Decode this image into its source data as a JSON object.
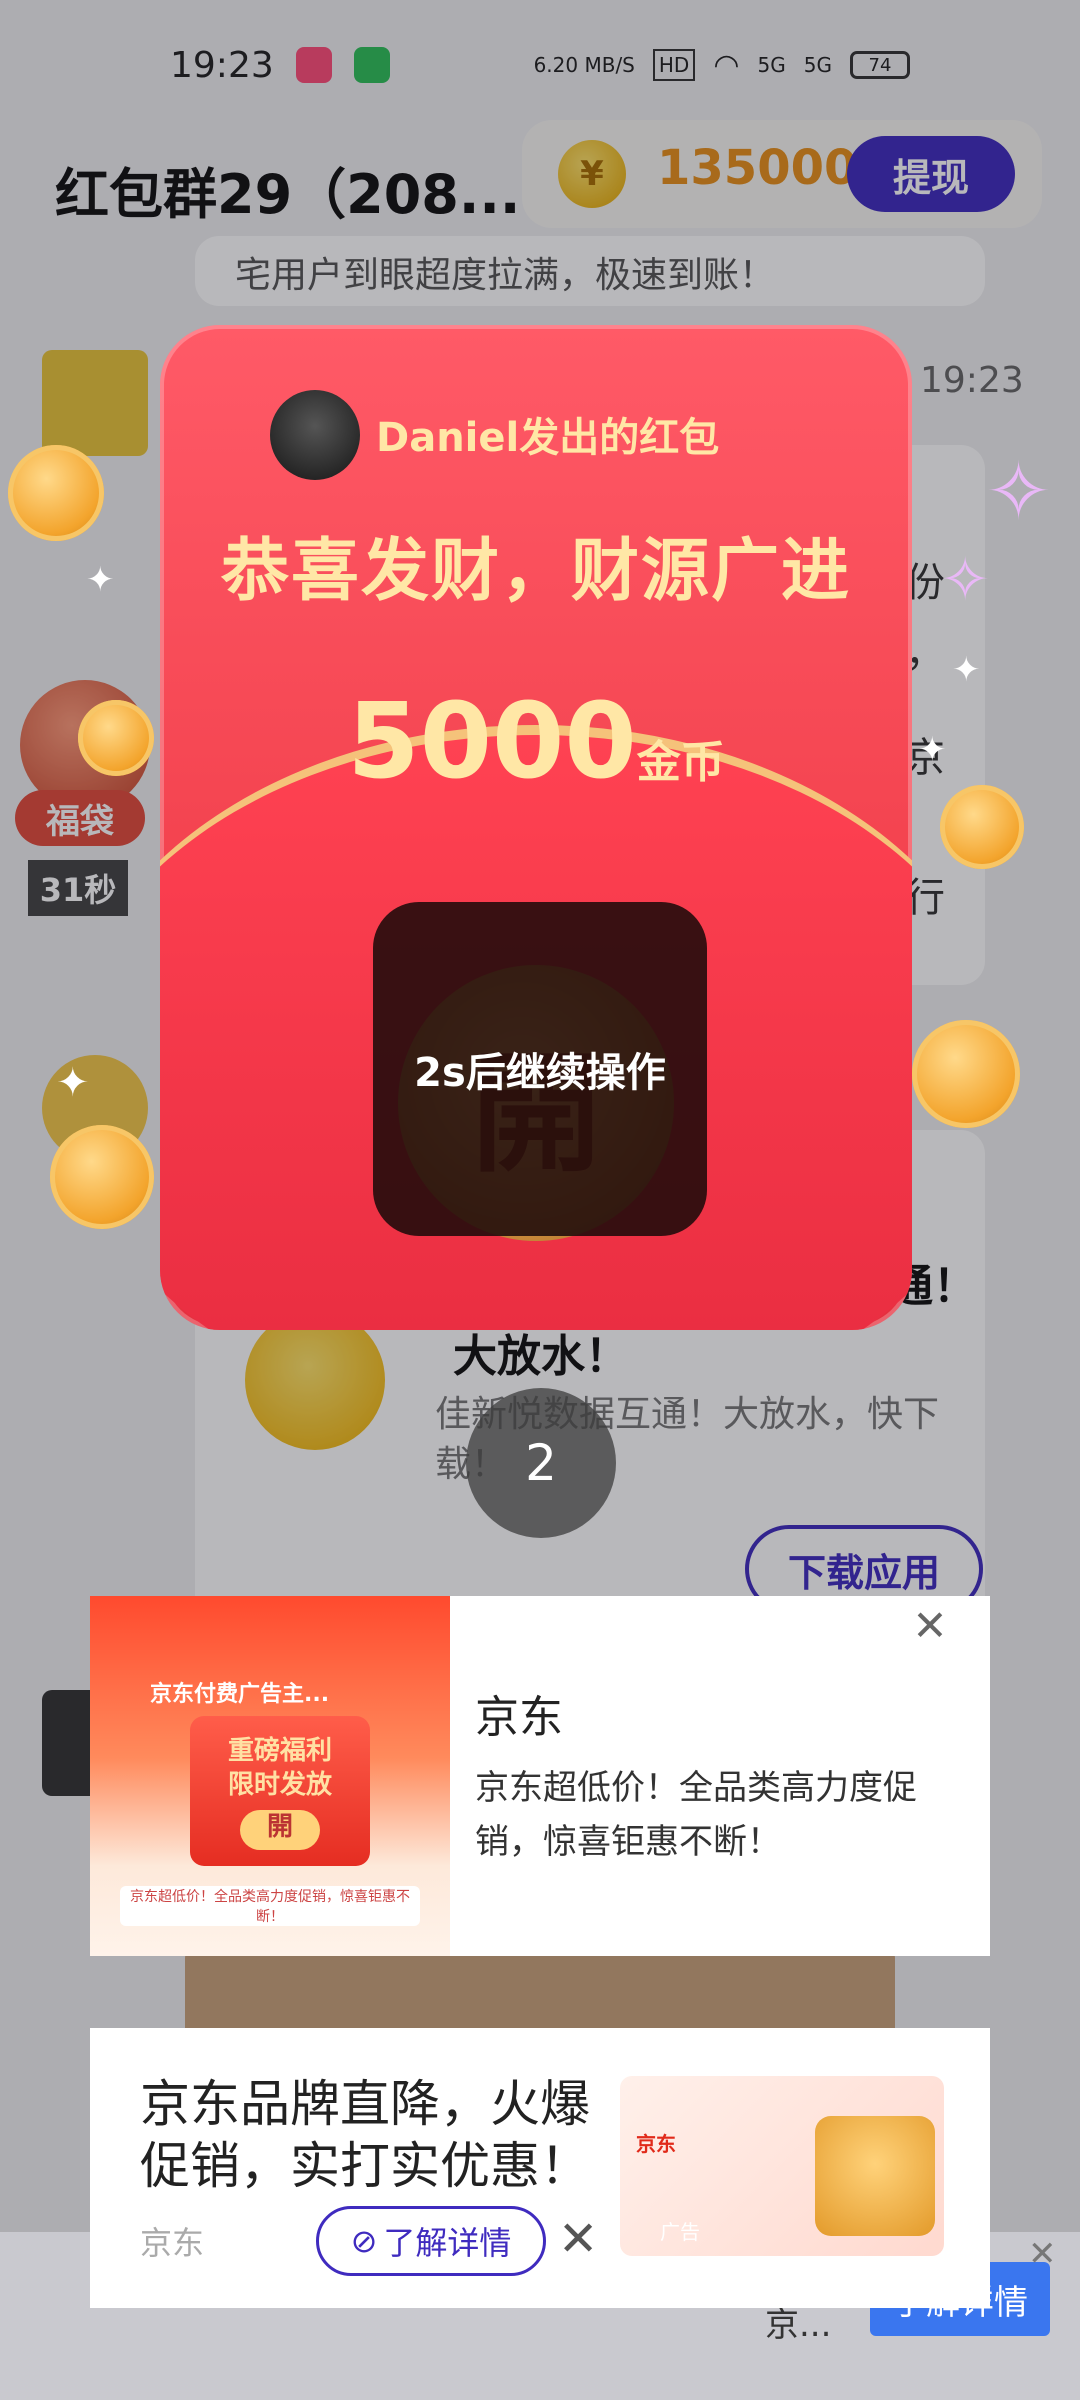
{
  "status_bar": {
    "time": "19:23",
    "net_speed": "6.20 MB/S",
    "hd": "HD",
    "sig1": "5G",
    "sig2": "5G",
    "battery": "74"
  },
  "header": {
    "group_title": "红包群29（208...",
    "coins": "135000",
    "coin_symbol": "¥",
    "withdraw_label": "提现"
  },
  "chat": {
    "time": "19:23",
    "fudai_label": "福袋",
    "fudai_seconds": "31秒",
    "partial_top": "宅用户到眼超度拉满，极速到账！",
    "partial_right": [
      "份",
      "，",
      "京",
      "行"
    ],
    "ad_title_partial": "互通！",
    "ad_title2": "大放水！",
    "ad_body": "佳新悦数据互通！大放水，快下载！",
    "download_label": "下载应用"
  },
  "red_packet": {
    "sender": "Daniel发出的红包",
    "wish": "恭喜发财，财源广进",
    "amount": "5000",
    "unit": "金币",
    "open_char": "開",
    "overlay_text": "2s后继续操作"
  },
  "countdown": "2",
  "ad1": {
    "brand": "京东",
    "description": "京东超低价！全品类高力度促销，惊喜钜惠不断！",
    "thumb_title": "京东付费广告主...",
    "thumb_box": "重磅福利\n限时发放",
    "thumb_open": "開",
    "thumb_caption": "京东超低价！全品类高力度促销，惊喜钜惠不断！",
    "close": "✕"
  },
  "ad2": {
    "headline": "京东品牌直降，火爆促销，实打实优惠！",
    "brand": "京东",
    "details_label": "了解详情",
    "close": "✕",
    "thumb_brand": "京东",
    "ad_tag": "广告"
  },
  "bottom_banner": {
    "brand": "京...",
    "details_label": "了解详情",
    "close": "✕"
  }
}
